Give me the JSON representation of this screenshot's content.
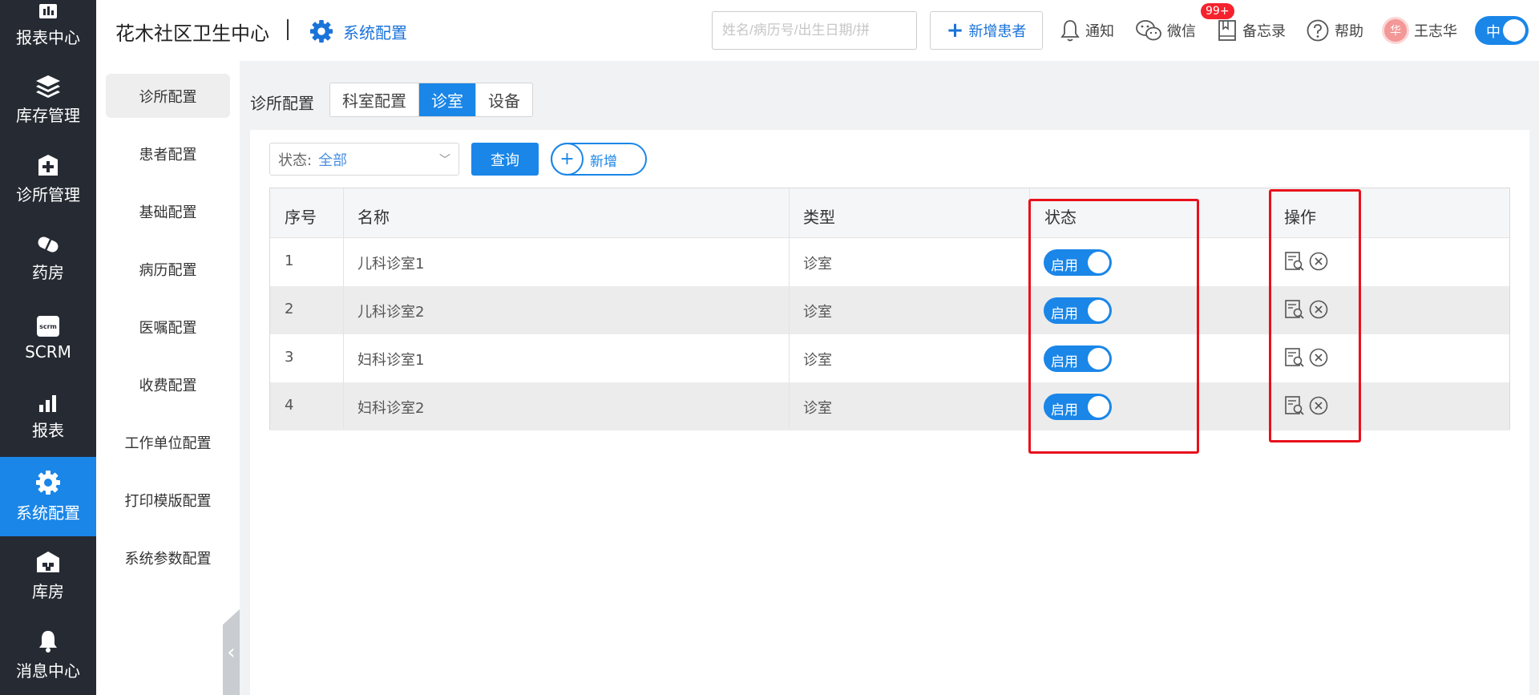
{
  "nav": {
    "items": [
      {
        "label": "报表中心",
        "icon": "report-center-icon"
      },
      {
        "label": "库存管理",
        "icon": "stack-layers-icon"
      },
      {
        "label": "诊所管理",
        "icon": "medical-kit-icon"
      },
      {
        "label": "药房",
        "icon": "pill-icon"
      },
      {
        "label": "SCRM",
        "icon": "scrm-icon"
      },
      {
        "label": "报表",
        "icon": "bar-chart-icon"
      },
      {
        "label": "系统配置",
        "icon": "gear-icon",
        "active": true
      },
      {
        "label": "库房",
        "icon": "warehouse-icon"
      },
      {
        "label": "消息中心",
        "icon": "bell-icon"
      }
    ]
  },
  "header": {
    "clinic_name": "花木社区卫生中心",
    "module": "系统配置",
    "search_placeholder": "姓名/病历号/出生日期/拼",
    "add_patient": "新增患者",
    "notify": "通知",
    "notify_badge": "99+",
    "wechat": "微信",
    "memo": "备忘录",
    "help": "帮助",
    "avatar_char": "华",
    "user": "王志华",
    "lang": "中"
  },
  "sidebar": {
    "items": [
      "诊所配置",
      "患者配置",
      "基础配置",
      "病历配置",
      "医嘱配置",
      "收费配置",
      "工作单位配置",
      "打印模版配置",
      "系统参数配置"
    ],
    "active_index": 0
  },
  "breadcrumb": "诊所配置",
  "tabs": [
    "科室配置",
    "诊室",
    "设备"
  ],
  "active_tab": 1,
  "filter": {
    "label": "状态:",
    "value": "全部"
  },
  "buttons": {
    "query": "查询",
    "add": "新增"
  },
  "table": {
    "headers": [
      "序号",
      "名称",
      "类型",
      "状态",
      "操作"
    ],
    "rows": [
      {
        "no": "1",
        "name": "儿科诊室1",
        "type": "诊室",
        "status": "启用"
      },
      {
        "no": "2",
        "name": "儿科诊室2",
        "type": "诊室",
        "status": "启用"
      },
      {
        "no": "3",
        "name": "妇科诊室1",
        "type": "诊室",
        "status": "启用"
      },
      {
        "no": "4",
        "name": "妇科诊室2",
        "type": "诊室",
        "status": "启用"
      }
    ]
  },
  "colors": {
    "accent": "#1a86e8",
    "nav_bg": "#262b33",
    "highlight": "#e8101c"
  }
}
